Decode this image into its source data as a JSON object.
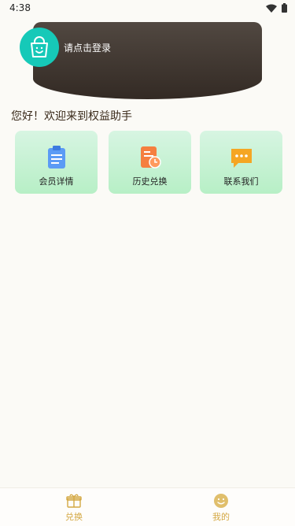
{
  "status": {
    "time": "4:38"
  },
  "header": {
    "login_prompt": "请点击登录"
  },
  "welcome": "您好！欢迎来到权益助手",
  "cards": [
    {
      "label": "会员详情",
      "icon": "clipboard-icon"
    },
    {
      "label": "历史兑换",
      "icon": "history-document-icon"
    },
    {
      "label": "联系我们",
      "icon": "chat-bubble-icon"
    }
  ],
  "tabs": [
    {
      "label": "兑换",
      "icon": "gift-icon"
    },
    {
      "label": "我的",
      "icon": "smile-icon"
    }
  ],
  "colors": {
    "accent": "#d4a843",
    "header_bg": "#3e3530",
    "avatar": "#16c9b8",
    "card_bg": "#c5f2d3"
  }
}
